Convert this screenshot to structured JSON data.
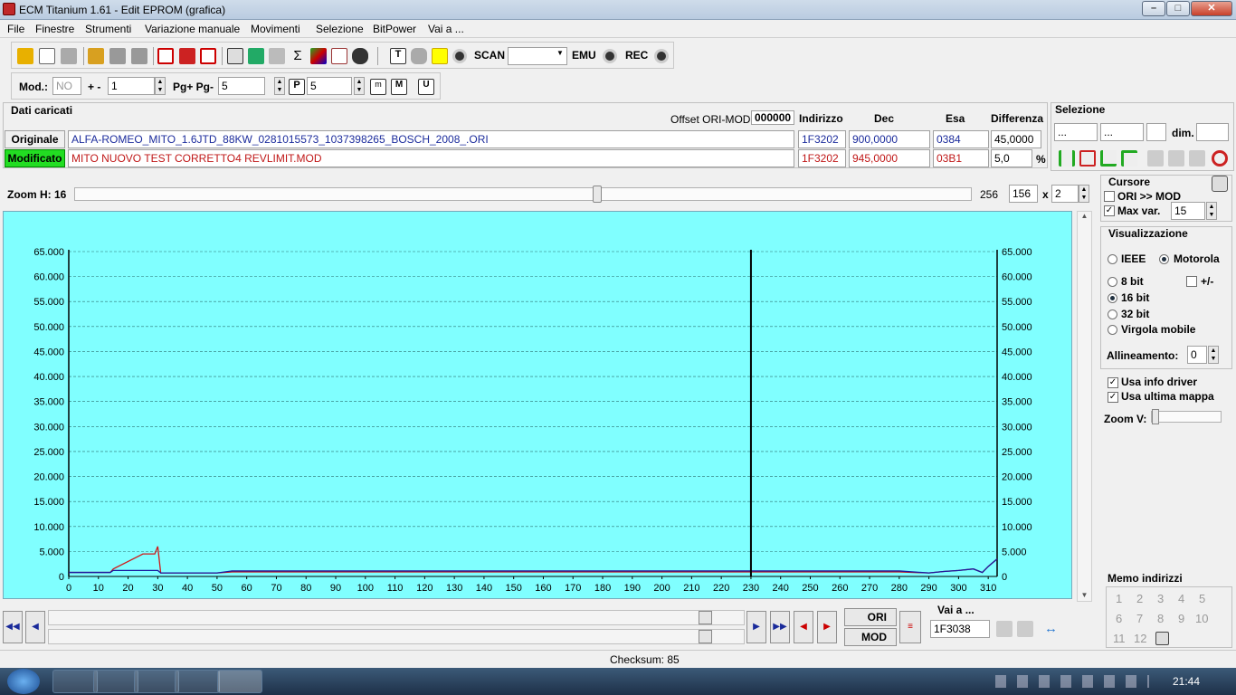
{
  "window": {
    "title": "ECM Titanium 1.61 - Edit EPROM (grafica)"
  },
  "menu": [
    "File",
    "Finestre",
    "Strumenti",
    "Variazione manuale",
    "Movimenti",
    "Selezione",
    "BitPower",
    "Vai a ..."
  ],
  "toolbar": {
    "scan_label": "SCAN",
    "emu_label": "EMU",
    "rec_label": "REC",
    "scan_value": ""
  },
  "toolbar2": {
    "mod_label": "Mod.:",
    "mod_value": "NO",
    "plusminus_label": "+ -",
    "plusminus_value": "1",
    "pg_label": "Pg+ Pg-",
    "pg_value": "5",
    "p_value": "5"
  },
  "data": {
    "section_title": "Dati caricati",
    "offset_label": "Offset ORI-MOD",
    "offset_value": "000000",
    "col_indirizzo": "Indirizzo",
    "col_dec": "Dec",
    "col_esa": "Esa",
    "col_diff": "Differenza",
    "ori_label": "Originale",
    "mod_label": "Modificato",
    "ori_file": "ALFA-ROMEO_MITO_1.6JTD_88KW_0281015573_1037398265_BOSCH_2008_.ORI",
    "mod_file": "MITO NUOVO TEST CORRETTO4 REVLIMIT.MOD",
    "ori_addr": "1F3202",
    "ori_dec": "900,0000",
    "ori_esa": "0384",
    "ori_diff": "45,0000",
    "mod_addr": "1F3202",
    "mod_dec": "945,0000",
    "mod_esa": "03B1",
    "mod_diff": "5,0",
    "pct": "%"
  },
  "selezione": {
    "title": "Selezione",
    "f1": "...",
    "f2": "...",
    "f3": "",
    "dim_label": "dim.",
    "dim_value": ""
  },
  "zoom": {
    "label": "Zoom H: 16",
    "max": "256",
    "value": "156",
    "x_label": "x",
    "mult": "2"
  },
  "cursore": {
    "title": "Cursore",
    "ori_mod": "ORI >> MOD",
    "max_var_label": "Max var.",
    "max_var_value": "15"
  },
  "vis": {
    "title": "Visualizzazione",
    "ieee": "IEEE",
    "motorola": "Motorola",
    "b8": "8 bit",
    "plusminus": "+/-",
    "b16": "16 bit",
    "b32": "32 bit",
    "float": "Virgola mobile",
    "align_label": "Allineamento:",
    "align_value": "0",
    "usa_info": "Usa info driver",
    "usa_mappa": "Usa ultima mappa",
    "zoomv": "Zoom V:"
  },
  "memo": {
    "title": "Memo indirizzi",
    "items": [
      "1",
      "2",
      "3",
      "4",
      "5",
      "6",
      "7",
      "8",
      "9",
      "10",
      "11",
      "12"
    ]
  },
  "bottom": {
    "ori_btn": "ORI",
    "mod_btn": "MOD",
    "vai_label": "Vai a ...",
    "vai_value": "1F3038",
    "checksum": "Checksum: 85"
  },
  "taskbar": {
    "clock": "21:44"
  },
  "colors": {
    "chart_bg": "#80ffff",
    "ori_line": "#d01818",
    "mod_line": "#1a1aa0"
  },
  "chart_data": {
    "type": "line",
    "x_ticks": [
      0,
      10,
      20,
      30,
      40,
      50,
      60,
      70,
      80,
      90,
      100,
      110,
      120,
      130,
      140,
      150,
      160,
      170,
      180,
      190,
      200,
      210,
      220,
      230,
      240,
      250,
      260,
      270,
      280,
      290,
      300,
      310
    ],
    "y_ticks": [
      "0",
      "5.000",
      "10.000",
      "15.000",
      "20.000",
      "25.000",
      "30.000",
      "35.000",
      "40.000",
      "45.000",
      "50.000",
      "55.000",
      "60.000",
      "65.000"
    ],
    "xlim": [
      0,
      313
    ],
    "ylim": [
      0,
      65000
    ],
    "cursor_x": 230,
    "grid": true,
    "series": [
      {
        "color": "#d01818",
        "x": [
          0,
          14,
          15,
          20,
          25,
          29,
          30,
          31,
          35,
          50,
          55,
          60,
          80,
          90,
          100,
          120,
          140,
          160,
          180,
          200,
          220,
          230,
          240,
          260,
          280,
          290,
          295,
          300,
          305,
          308,
          310,
          313
        ],
        "y": [
          800,
          800,
          1500,
          3000,
          4500,
          4500,
          6000,
          700,
          700,
          700,
          900,
          900,
          900,
          900,
          900,
          900,
          900,
          900,
          900,
          900,
          900,
          900,
          900,
          900,
          900,
          700,
          1000,
          1200,
          1500,
          800,
          2000,
          3500
        ]
      },
      {
        "color": "#1a1aa0",
        "x": [
          0,
          14,
          15,
          20,
          25,
          29,
          30,
          31,
          35,
          50,
          55,
          60,
          80,
          90,
          100,
          120,
          140,
          160,
          180,
          200,
          220,
          230,
          240,
          260,
          280,
          290,
          295,
          300,
          305,
          308,
          310,
          313
        ],
        "y": [
          800,
          800,
          1200,
          1200,
          1200,
          1200,
          1200,
          700,
          700,
          700,
          1100,
          1100,
          1100,
          1100,
          1100,
          1100,
          1100,
          1100,
          1100,
          1100,
          1100,
          1100,
          1100,
          1100,
          1100,
          700,
          1000,
          1200,
          1500,
          800,
          2000,
          3500
        ]
      }
    ]
  }
}
